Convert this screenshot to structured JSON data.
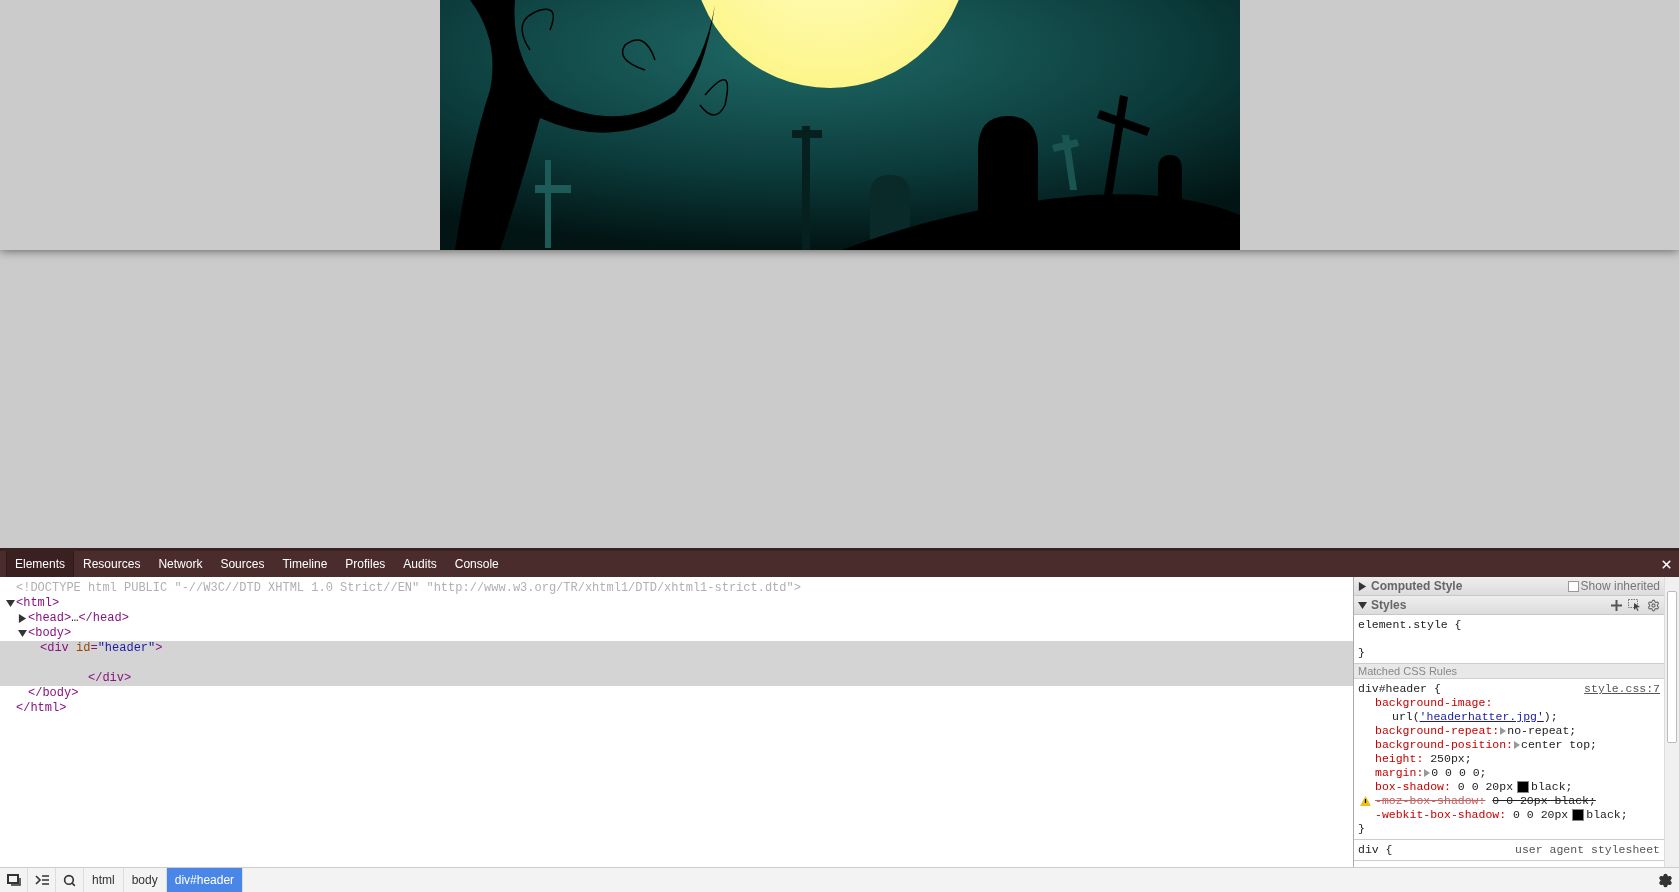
{
  "devtools": {
    "tabs": [
      {
        "label": "Elements",
        "selected": true
      },
      {
        "label": "Resources",
        "selected": false
      },
      {
        "label": "Network",
        "selected": false
      },
      {
        "label": "Sources",
        "selected": false
      },
      {
        "label": "Timeline",
        "selected": false
      },
      {
        "label": "Profiles",
        "selected": false
      },
      {
        "label": "Audits",
        "selected": false
      },
      {
        "label": "Console",
        "selected": false
      }
    ],
    "dom_tree": [
      {
        "line": [
          {
            "kind": "doctype",
            "text": "<!DOCTYPE html PUBLIC \"-//W3C//DTD XHTML 1.0 Strict//EN\" \"http://www.w3.org/TR/xhtml1/DTD/xhtml1-strict.dtd\">"
          }
        ],
        "selected": false
      },
      {
        "line": [
          {
            "kind": "tag",
            "text": "<html>"
          }
        ],
        "expanded": true,
        "selected": false,
        "close": [
          {
            "kind": "tag",
            "text": "</html>"
          }
        ],
        "children": [
          {
            "line": [
              {
                "kind": "tag",
                "text": "<head>"
              },
              {
                "kind": "plain",
                "text": "…"
              },
              {
                "kind": "tag",
                "text": "</head>"
              }
            ],
            "expanded": false,
            "selected": false
          },
          {
            "line": [
              {
                "kind": "tag",
                "text": "<body>"
              }
            ],
            "expanded": true,
            "selected": false,
            "close": [
              {
                "kind": "tag",
                "text": "</body>"
              }
            ],
            "children": [
              {
                "line": [
                  {
                    "kind": "tag",
                    "text": "<div"
                  },
                  {
                    "kind": "attr",
                    "text": " id"
                  },
                  {
                    "kind": "tag",
                    "text": "="
                  },
                  {
                    "kind": "value",
                    "text": "\"header\""
                  },
                  {
                    "kind": "tag",
                    "text": ">"
                  }
                ],
                "selected": true,
                "close": [
                  {
                    "kind": "tag",
                    "text": "</div>"
                  }
                ]
              }
            ]
          }
        ]
      }
    ],
    "sidebar": {
      "computed_style": {
        "title": "Computed Style",
        "expanded": false,
        "show_inherited": {
          "label": "Show inherited",
          "checked": false
        }
      },
      "styles": {
        "title": "Styles",
        "expanded": true
      },
      "element_style": {
        "selector": "element.style {",
        "close": "}"
      },
      "matched_header": "Matched CSS Rules",
      "rules": [
        {
          "selector": "div#header {",
          "source": "style.css:7",
          "close": "}",
          "properties": [
            {
              "name": "background-image:",
              "wrap": true,
              "value": [
                {
                  "kind": "text",
                  "text": "url("
                },
                {
                  "kind": "link",
                  "text": "'headerhatter.jpg'"
                },
                {
                  "kind": "text",
                  "text": ");"
                }
              ],
              "overridden": false,
              "warning": false
            },
            {
              "name": "background-repeat:",
              "expandable": true,
              "value": [
                {
                  "kind": "text",
                  "text": "no-repeat;"
                }
              ],
              "overridden": false,
              "warning": false
            },
            {
              "name": "background-position:",
              "expandable": true,
              "value": [
                {
                  "kind": "text",
                  "text": "center top;"
                }
              ],
              "overridden": false,
              "warning": false
            },
            {
              "name": "height:",
              "value": [
                {
                  "kind": "text",
                  "text": "250px;"
                }
              ],
              "overridden": false,
              "warning": false
            },
            {
              "name": "margin:",
              "expandable": true,
              "value": [
                {
                  "kind": "text",
                  "text": "0 0 0 0;"
                }
              ],
              "overridden": false,
              "warning": false
            },
            {
              "name": "box-shadow:",
              "value": [
                {
                  "kind": "text",
                  "text": "0 0 20px"
                },
                {
                  "kind": "swatch",
                  "color": "#000000"
                },
                {
                  "kind": "text",
                  "text": "black;"
                }
              ],
              "overridden": false,
              "warning": false
            },
            {
              "name": "-moz-box-shadow:",
              "value": [
                {
                  "kind": "text",
                  "text": "0 0 20px black;"
                }
              ],
              "overridden": true,
              "warning": true
            },
            {
              "name": "-webkit-box-shadow:",
              "value": [
                {
                  "kind": "text",
                  "text": "0 0 20px"
                },
                {
                  "kind": "swatch",
                  "color": "#000000"
                },
                {
                  "kind": "text",
                  "text": "black;"
                }
              ],
              "overridden": false,
              "warning": false
            }
          ]
        },
        {
          "selector": "div {",
          "source": "user agent stylesheet"
        }
      ]
    },
    "breadcrumbs": [
      {
        "label": "html",
        "selected": false
      },
      {
        "label": "body",
        "selected": false
      },
      {
        "label": "div#header",
        "selected": true
      }
    ]
  }
}
